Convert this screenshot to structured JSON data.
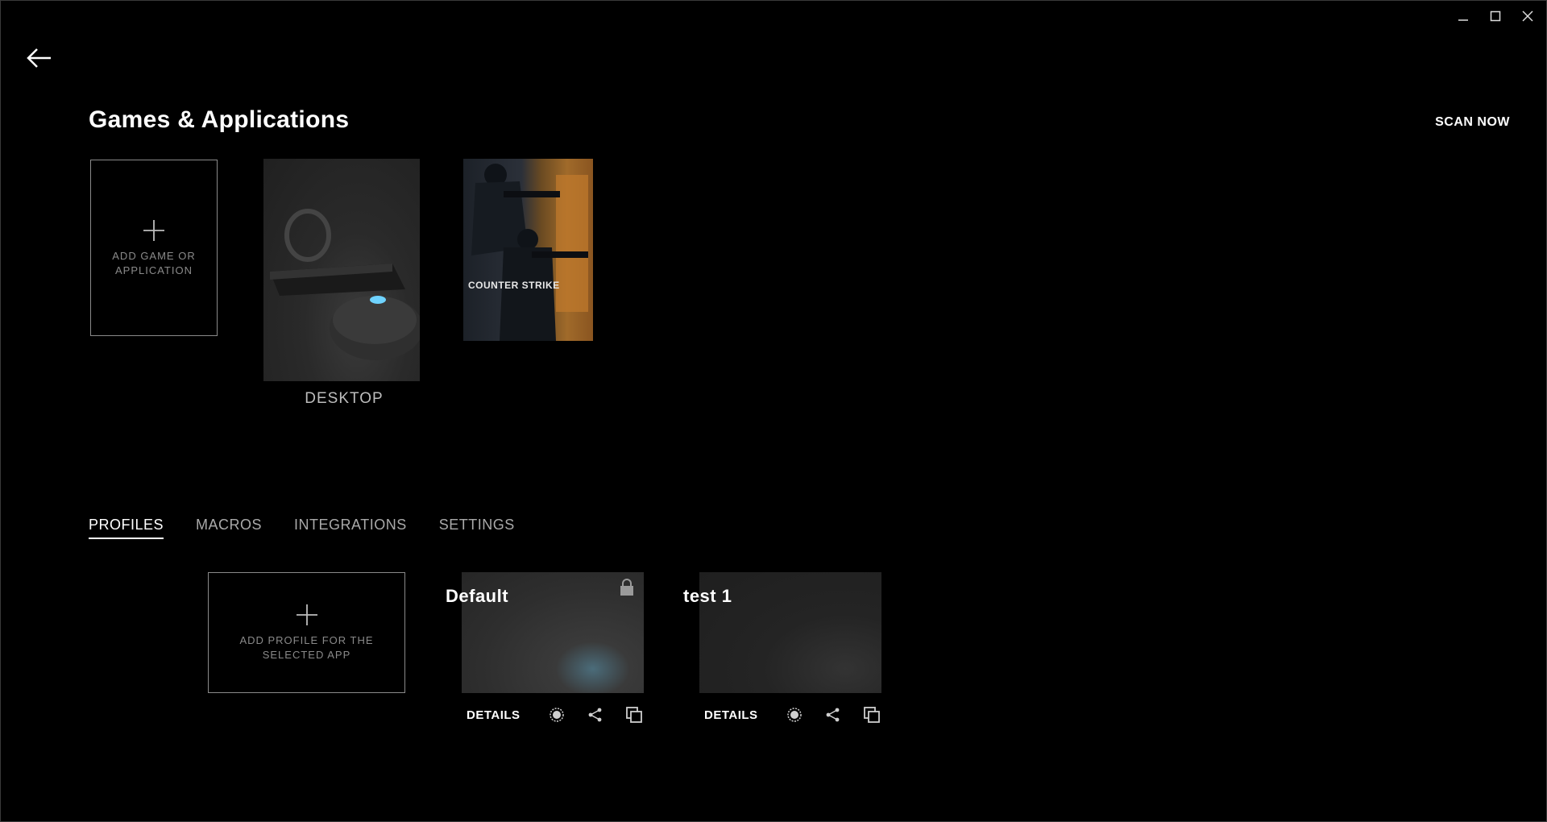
{
  "window": {
    "minimize_icon": "minimize-icon",
    "maximize_icon": "maximize-icon",
    "close_icon": "close-icon"
  },
  "nav": {
    "back_icon": "back-arrow-icon"
  },
  "page": {
    "title": "Games & Applications",
    "scan_now": "SCAN NOW"
  },
  "games": {
    "add_label": "ADD GAME OR APPLICATION",
    "desktop_label": "DESKTOP",
    "csgo_logo_text": "COUNTER STRIKE"
  },
  "tabs": [
    {
      "label": "PROFILES",
      "active": true
    },
    {
      "label": "MACROS",
      "active": false
    },
    {
      "label": "INTEGRATIONS",
      "active": false
    },
    {
      "label": "SETTINGS",
      "active": false
    }
  ],
  "profiles": {
    "add_label": "ADD PROFILE FOR THE SELECTED APP",
    "items": [
      {
        "name": "Default",
        "locked": true,
        "details_label": "DETAILS"
      },
      {
        "name": "test 1",
        "locked": false,
        "details_label": "DETAILS"
      }
    ]
  },
  "colors": {
    "background": "#000000",
    "text": "#ffffff",
    "muted": "#8a8a8a",
    "tab_inactive": "#a9a9a9"
  }
}
